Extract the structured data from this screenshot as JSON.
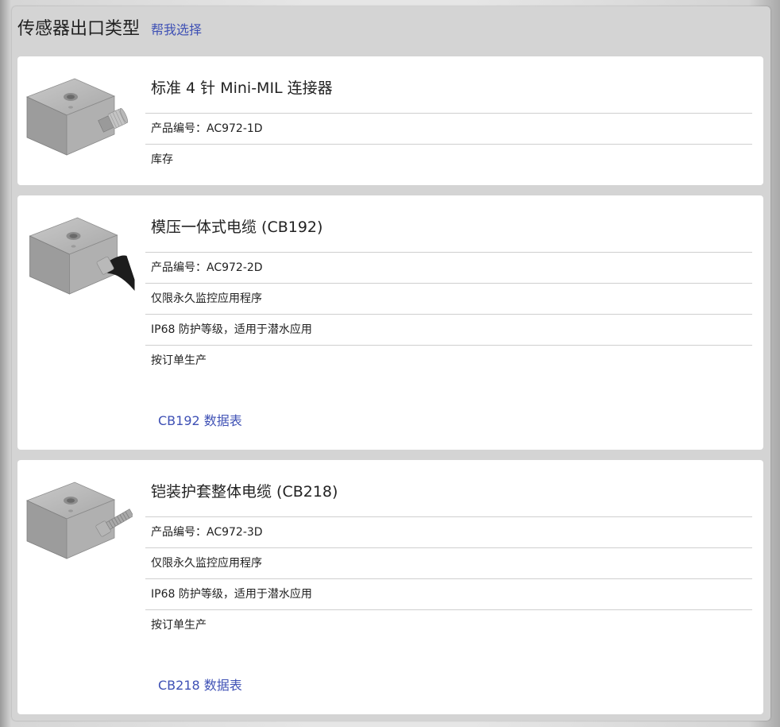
{
  "header": {
    "title": "传感器出口类型",
    "help_link": "帮我选择"
  },
  "cards": [
    {
      "title": "标准 4 针 Mini-MIL 连接器",
      "connector": "mil-connector",
      "rows": [
        "产品编号：AC972-1D",
        "库存"
      ]
    },
    {
      "title": "模压一体式电缆 (CB192)",
      "connector": "molded-cable",
      "rows": [
        "产品编号：AC972-2D",
        "仅限永久监控应用程序",
        "IP68 防护等级，适用于潜水应用",
        "按订单生产"
      ],
      "datasheet": "CB192 数据表"
    },
    {
      "title": "铠装护套整体电缆 (CB218)",
      "connector": "armored-cable",
      "rows": [
        "产品编号：AC972-3D",
        "仅限永久监控应用程序",
        "IP68 防护等级，适用于潜水应用",
        "按订单生产"
      ],
      "datasheet": "CB218 数据表"
    }
  ]
}
